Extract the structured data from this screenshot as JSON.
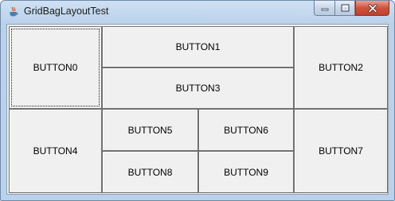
{
  "window": {
    "title": "GridBagLayoutTest"
  },
  "icons": {
    "app": "java-coffee-cup-icon",
    "minimize": "minimize-icon",
    "maximize": "maximize-icon",
    "close": "close-icon"
  },
  "colors": {
    "titlebar": "#b9d1ea",
    "client_background": "#f0f0f0",
    "button_border": "#707070",
    "close_button": "#c9462f"
  },
  "buttons": {
    "b0": "BUTTON0",
    "b1": "BUTTON1",
    "b2": "BUTTON2",
    "b3": "BUTTON3",
    "b4": "BUTTON4",
    "b5": "BUTTON5",
    "b6": "BUTTON6",
    "b7": "BUTTON7",
    "b8": "BUTTON8",
    "b9": "BUTTON9"
  }
}
